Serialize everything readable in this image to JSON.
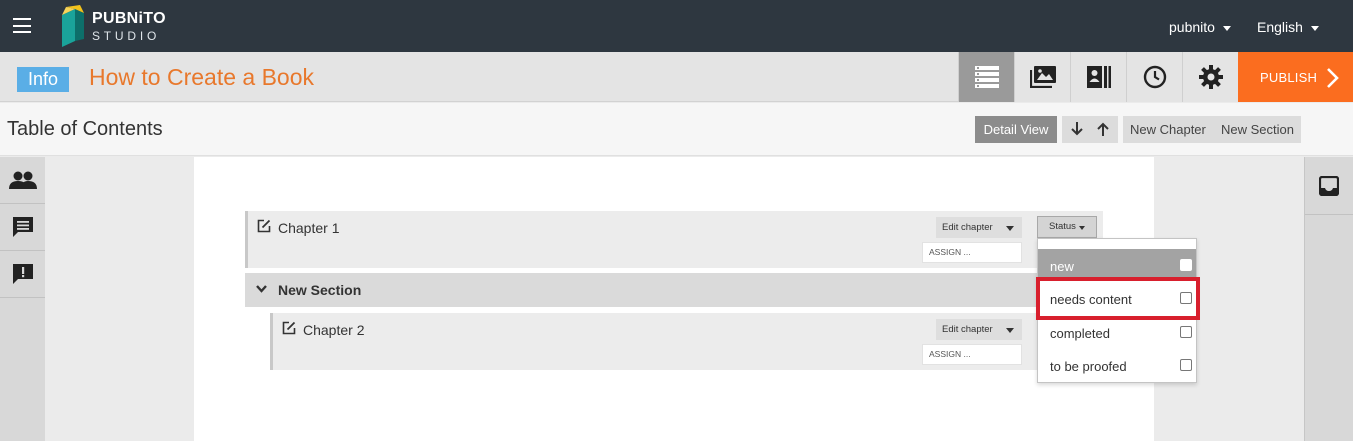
{
  "topbar": {
    "brand_line1": "PUBNiTO",
    "brand_line2": "STUDIO",
    "user": "pubnito",
    "language": "English"
  },
  "titlebar": {
    "info_label": "Info",
    "book_title": "How to Create a Book",
    "publish_label": "PUBLISH",
    "tools": [
      "list-view-icon",
      "images-icon",
      "contact-card-icon",
      "history-clock-icon",
      "settings-gear-icon"
    ]
  },
  "toc": {
    "title": "Table of Contents",
    "detail_view_label": "Detail View",
    "new_chapter_label": "New Chapter",
    "new_section_label": "New Section"
  },
  "left_panel": [
    "users-icon",
    "comments-icon",
    "alert-comment-icon"
  ],
  "right_panel": [
    "inbox-icon"
  ],
  "chapters": [
    {
      "title": "Chapter 1",
      "edit_label": "Edit chapter",
      "assign_label": "ASSIGN ...",
      "status_label": "Status"
    },
    {
      "title": "Chapter 2",
      "edit_label": "Edit chapter",
      "assign_label": "ASSIGN ..."
    }
  ],
  "section": {
    "title": "New Section"
  },
  "status_options": [
    {
      "label": "new",
      "selected": true,
      "checked": false
    },
    {
      "label": "needs content",
      "selected": false,
      "checked": false
    },
    {
      "label": "completed",
      "selected": false,
      "checked": false
    },
    {
      "label": "to be proofed",
      "selected": false,
      "checked": false
    }
  ],
  "colors": {
    "topbar": "#2e3740",
    "accent_orange": "#fb6d1f",
    "title_orange": "#e8782c",
    "info_blue": "#5aaee6",
    "highlight_red": "#d81f2d"
  }
}
